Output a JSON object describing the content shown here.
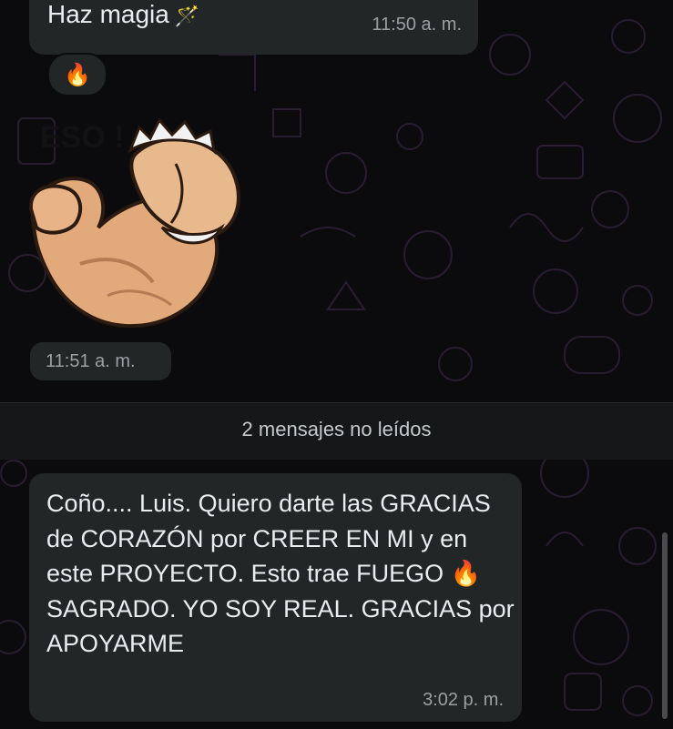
{
  "messages": {
    "first": {
      "text": "Haz magia",
      "wand_emoji": "🪄",
      "time": "11:50 a. m.",
      "reaction": "🔥"
    },
    "sticker": {
      "overlay_text": "ESO !",
      "time": "11:51 a. m.",
      "icon": "flexed-bicep-sticker"
    },
    "unread_divider": "2 mensajes no leídos",
    "second": {
      "text": "Coño.... Luis. Quiero darte las GRACIAS de CORAZÓN por CREER EN MI y en este PROYECTO. Esto trae FUEGO 🔥 SAGRADO. YO SOY REAL. GRACIAS por APOYARME",
      "time": "3:02 p. m."
    }
  },
  "colors": {
    "bubble": "#232626",
    "background": "#0b0b0d",
    "timestamp": "#9aa0a2",
    "wallpaper_pattern": "#2a1d33"
  }
}
